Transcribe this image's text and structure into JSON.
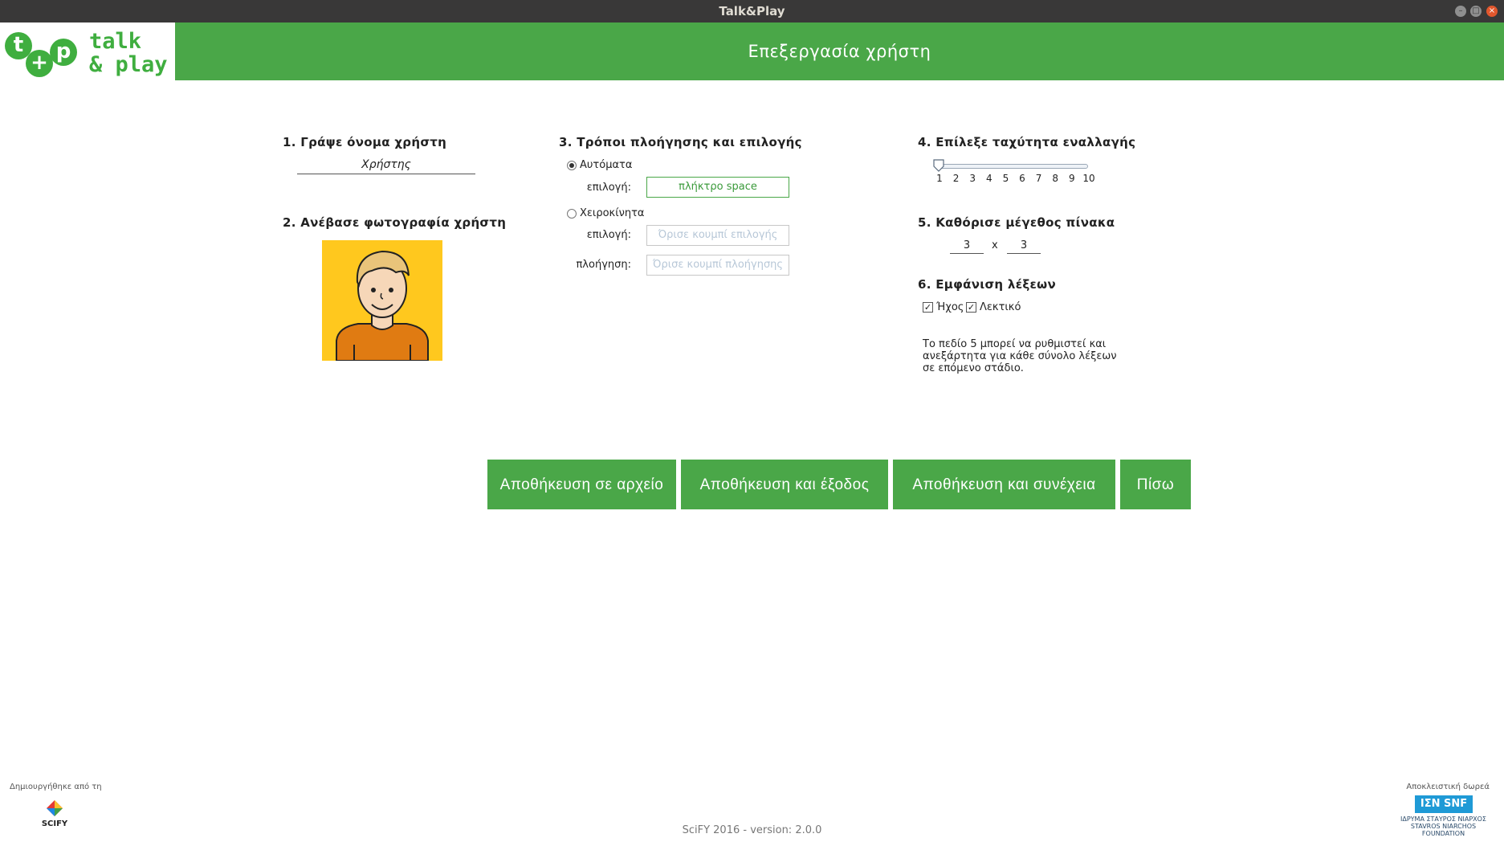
{
  "window": {
    "title": "Talk&Play"
  },
  "logo": {
    "t": "t",
    "plus": "+",
    "p": "p",
    "line1": "talk",
    "line2": "& play"
  },
  "header": {
    "title": "Επεξεργασία χρήστη"
  },
  "section1": {
    "heading": "1. Γράψε όνομα χρήστη",
    "username": "Χρήστης"
  },
  "section2": {
    "heading": "2. Ανέβασε φωτογραφία χρήστη"
  },
  "section3": {
    "heading": "3. Τρόποι πλοήγησης και επιλογής",
    "auto_label": "Αυτόματα",
    "auto_selected": true,
    "auto_select_label": "επιλογή:",
    "auto_select_value": "πλήκτρο space",
    "manual_label": "Χειροκίνητα",
    "manual_select_label": "επιλογή:",
    "manual_select_placeholder": "Όρισε κουμπί επιλογής",
    "manual_nav_label": "πλοήγηση:",
    "manual_nav_placeholder": "Όρισε κουμπί πλοήγησης"
  },
  "section4": {
    "heading": "4. Επίλεξε ταχύτητα εναλλαγής",
    "ticks": [
      "1",
      "2",
      "3",
      "4",
      "5",
      "6",
      "7",
      "8",
      "9",
      "10"
    ],
    "value": 1
  },
  "section5": {
    "heading": "5. Καθόρισε μέγεθος πίνακα",
    "rows": "3",
    "times": "x",
    "cols": "3"
  },
  "section6": {
    "heading": "6. Εμφάνιση λέξεων",
    "sound_label": "Ήχος",
    "sound_checked": true,
    "text_label": "Λεκτικό",
    "text_checked": true,
    "note_line1": "Το πεδίο 5 μπορεί να ρυθμιστεί και",
    "note_line2": "ανεξάρτητα για κάθε σύνολο λέξεων",
    "note_line3": "σε επόμενο στάδιο."
  },
  "buttons": {
    "save_file": "Αποθήκευση σε αρχείο",
    "save_exit": "Αποθήκευση και έξοδος",
    "save_continue": "Αποθήκευση και συνέχεια",
    "back": "Πίσω"
  },
  "footer": {
    "created_by": "Δημιουργήθηκε από τη",
    "scify_logo": "SCIFY",
    "donation": "Αποκλειστική δωρεά",
    "snf_logo": "ΙΣΝ SNF",
    "snf_line1": "ΙΔΡΥΜΑ ΣΤΑΥΡΟΣ ΝΙΑΡΧΟΣ",
    "snf_line2": "STAVROS NIARCHOS",
    "snf_line3": "FOUNDATION",
    "version": "SciFY 2016 - version: 2.0.0"
  },
  "colors": {
    "accent": "#4aa748",
    "avatar_bg": "#ffc81e",
    "titlebar": "#393838"
  }
}
